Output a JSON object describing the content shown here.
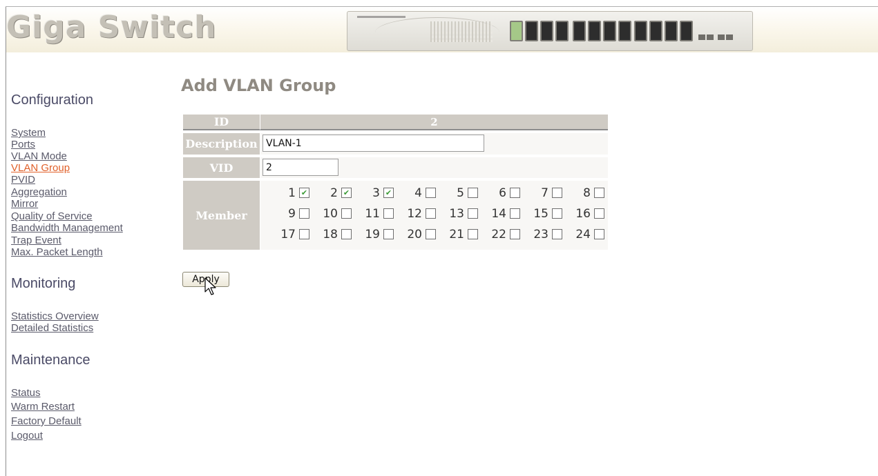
{
  "header": {
    "brand": "Giga Switch"
  },
  "sidebar": {
    "configuration": {
      "title": "Configuration",
      "items": [
        "System",
        "Ports",
        "VLAN Mode",
        "VLAN Group",
        "PVID",
        "Aggregation",
        "Mirror",
        "Quality of Service",
        "Bandwidth Management",
        "Trap Event",
        "Max. Packet Length"
      ],
      "active": "VLAN Group"
    },
    "monitoring": {
      "title": "Monitoring",
      "items": [
        "Statistics Overview",
        "Detailed Statistics"
      ]
    },
    "maintenance": {
      "title": "Maintenance",
      "items": [
        "Status",
        "Warm Restart",
        "Factory Default",
        "Logout"
      ]
    }
  },
  "main": {
    "title": "Add VLAN Group",
    "id_label": "ID",
    "id_value": "2",
    "description_label": "Description",
    "description_value": "VLAN-1",
    "vid_label": "VID",
    "vid_value": "2",
    "member_label": "Member",
    "members": [
      {
        "port": "1",
        "checked": true
      },
      {
        "port": "2",
        "checked": true
      },
      {
        "port": "3",
        "checked": true
      },
      {
        "port": "4",
        "checked": false
      },
      {
        "port": "5",
        "checked": false
      },
      {
        "port": "6",
        "checked": false
      },
      {
        "port": "7",
        "checked": false
      },
      {
        "port": "8",
        "checked": false
      },
      {
        "port": "9",
        "checked": false
      },
      {
        "port": "10",
        "checked": false
      },
      {
        "port": "11",
        "checked": false
      },
      {
        "port": "12",
        "checked": false
      },
      {
        "port": "13",
        "checked": false
      },
      {
        "port": "14",
        "checked": false
      },
      {
        "port": "15",
        "checked": false
      },
      {
        "port": "16",
        "checked": false
      },
      {
        "port": "17",
        "checked": false
      },
      {
        "port": "18",
        "checked": false
      },
      {
        "port": "19",
        "checked": false
      },
      {
        "port": "20",
        "checked": false
      },
      {
        "port": "21",
        "checked": false
      },
      {
        "port": "22",
        "checked": false
      },
      {
        "port": "23",
        "checked": false
      },
      {
        "port": "24",
        "checked": false
      }
    ],
    "apply_label": "Apply"
  },
  "colors": {
    "link": "#5a5a6a",
    "active_link": "#e0602a",
    "section_title": "#4a4a66",
    "label_cell": "#cfcbc4",
    "checkmark": "#3a9a34"
  }
}
